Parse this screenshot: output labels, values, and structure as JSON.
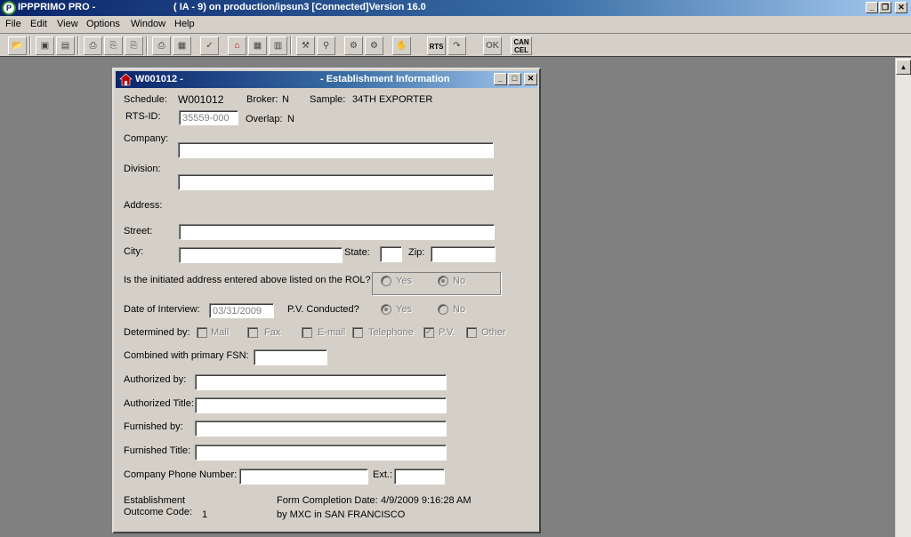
{
  "app": {
    "title": "IPPPRIMO PRO -",
    "title_suffix": "( IA - 9) on production/ipsun3 [Connected]Version 16.0"
  },
  "menu": [
    "File",
    "Edit",
    "View",
    "Options",
    "Window",
    "Help"
  ],
  "toolbar": {
    "rts_label": "RTS",
    "ok_label": "OK",
    "cancel_label": "CAN CEL"
  },
  "dialog": {
    "title_id": "W001012 -",
    "title_name": "- Establishment Information",
    "schedule_label": "Schedule:",
    "schedule_value": "W001012",
    "broker_label": "Broker:",
    "broker_value": "N",
    "sample_label": "Sample:",
    "sample_value": "34TH EXPORTER",
    "rtsid_label": "RTS-ID:",
    "rtsid_value": "35559-000",
    "overlap_label": "Overlap:",
    "overlap_value": "N",
    "company_label": "Company:",
    "division_label": "Division:",
    "address_label": "Address:",
    "street_label": "Street:",
    "city_label": "City:",
    "state_label": "State:",
    "zip_label": "Zip:",
    "rol_question": "Is the initiated address entered above listed on the ROL?",
    "rol_yes": "Yes",
    "rol_no": "No",
    "interview_label": "Date of Interview:",
    "interview_value": "03/31/2009",
    "pv_label": "P.V. Conducted?",
    "pv_yes": "Yes",
    "pv_no": "No",
    "determined_label": "Determined by:",
    "determined_options": [
      "Mail",
      "Fax",
      "E-mail",
      "Telephone",
      "P.V.",
      "Other"
    ],
    "combined_label": "Combined with primary FSN:",
    "authorized_by_label": "Authorized by:",
    "authorized_title_label": "Authorized Title:",
    "furnished_by_label": "Furnished by:",
    "furnished_title_label": "Furnished Title:",
    "phone_label": "Company Phone Number:",
    "ext_label": "Ext.:",
    "outcome_label_1": "Establishment",
    "outcome_label_2": "Outcome Code:",
    "outcome_value": "1",
    "completion_label": "Form Completion Date:",
    "completion_value": "4/9/2009 9:16:28 AM",
    "completion_by": "by MXC in SAN FRANCISCO"
  }
}
